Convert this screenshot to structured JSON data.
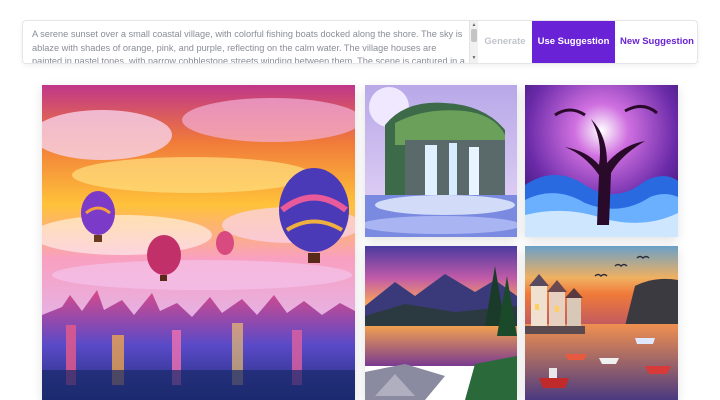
{
  "prompt": {
    "text": "A serene sunset over a small coastal village, with colorful fishing boats docked along the shore. The sky is ablaze with shades of orange, pink, and purple, reflecting on the calm water. The village houses are painted in pastel tones, with narrow cobblestone streets winding between them. The scene is captured in a"
  },
  "buttons": {
    "generate": "Generate",
    "use_suggestion": "Use Suggestion",
    "new_suggestion": "New Suggestion"
  },
  "colors": {
    "accent": "#6a22d6",
    "disabled_text": "#c2c4cc",
    "prompt_text": "#8a8d98"
  },
  "gallery": {
    "images": [
      {
        "id": "main",
        "subject": "hot air balloons over colorful city at sunset"
      },
      {
        "id": "waterfall",
        "subject": "waterfall cliff with moon"
      },
      {
        "id": "tree",
        "subject": "dark tree over swirling blue waves"
      },
      {
        "id": "lake",
        "subject": "mountain lake at dusk with wooden path"
      },
      {
        "id": "harbor",
        "subject": "coastal harbor village with boats at sunset"
      }
    ]
  }
}
